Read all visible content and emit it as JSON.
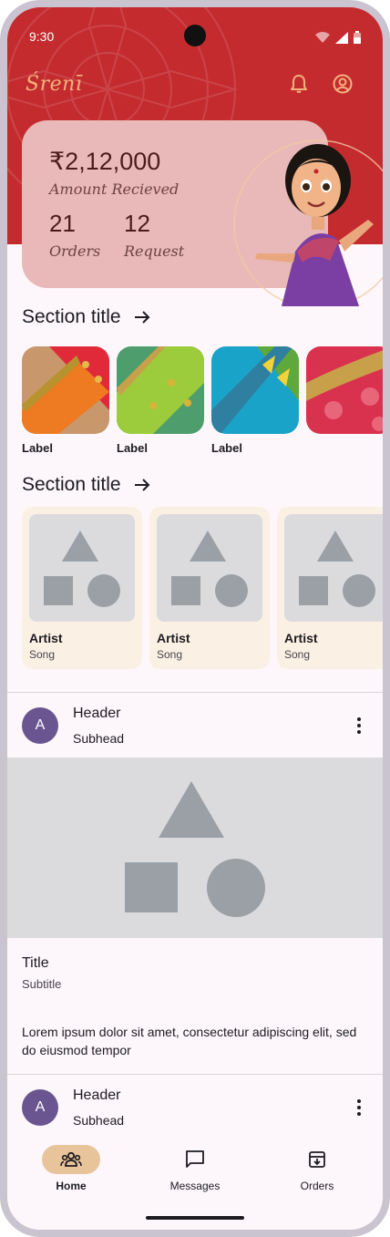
{
  "status": {
    "time": "9:30"
  },
  "brand": "Śrenī",
  "header": {
    "notification_icon": "bell-icon",
    "account_icon": "account-circle-icon"
  },
  "stats": {
    "amount": "₹2,12,000",
    "amount_label": "Amount Recieved",
    "orders_value": "21",
    "orders_label": "Orders",
    "requests_value": "12",
    "requests_label": "Request"
  },
  "section1": {
    "title": "Section title",
    "items": [
      {
        "label": "Label"
      },
      {
        "label": "Label"
      },
      {
        "label": "Label"
      },
      {
        "label": ""
      }
    ]
  },
  "section2": {
    "title": "Section title",
    "cards": [
      {
        "artist": "Artist",
        "song": "Song"
      },
      {
        "artist": "Artist",
        "song": "Song"
      },
      {
        "artist": "Artist",
        "song": "Song"
      }
    ]
  },
  "list1": {
    "avatar": "A",
    "header": "Header",
    "subhead": "Subhead"
  },
  "card": {
    "title": "Title",
    "subtitle": "Subtitle",
    "body": "Lorem ipsum dolor sit amet, consectetur adipiscing elit, sed do eiusmod tempor"
  },
  "list2": {
    "avatar": "A",
    "header": "Header",
    "subhead": "Subhead"
  },
  "nav": {
    "items": [
      {
        "label": "Home",
        "icon": "people-icon",
        "active": true
      },
      {
        "label": "Messages",
        "icon": "message-icon",
        "active": false
      },
      {
        "label": "Orders",
        "icon": "archive-icon",
        "active": false
      }
    ]
  },
  "colors": {
    "header_red": "#c42b2f",
    "card_pink": "#e8b9b8",
    "accent_tan": "#e8c49b",
    "avatar_purple": "#6a5590"
  }
}
